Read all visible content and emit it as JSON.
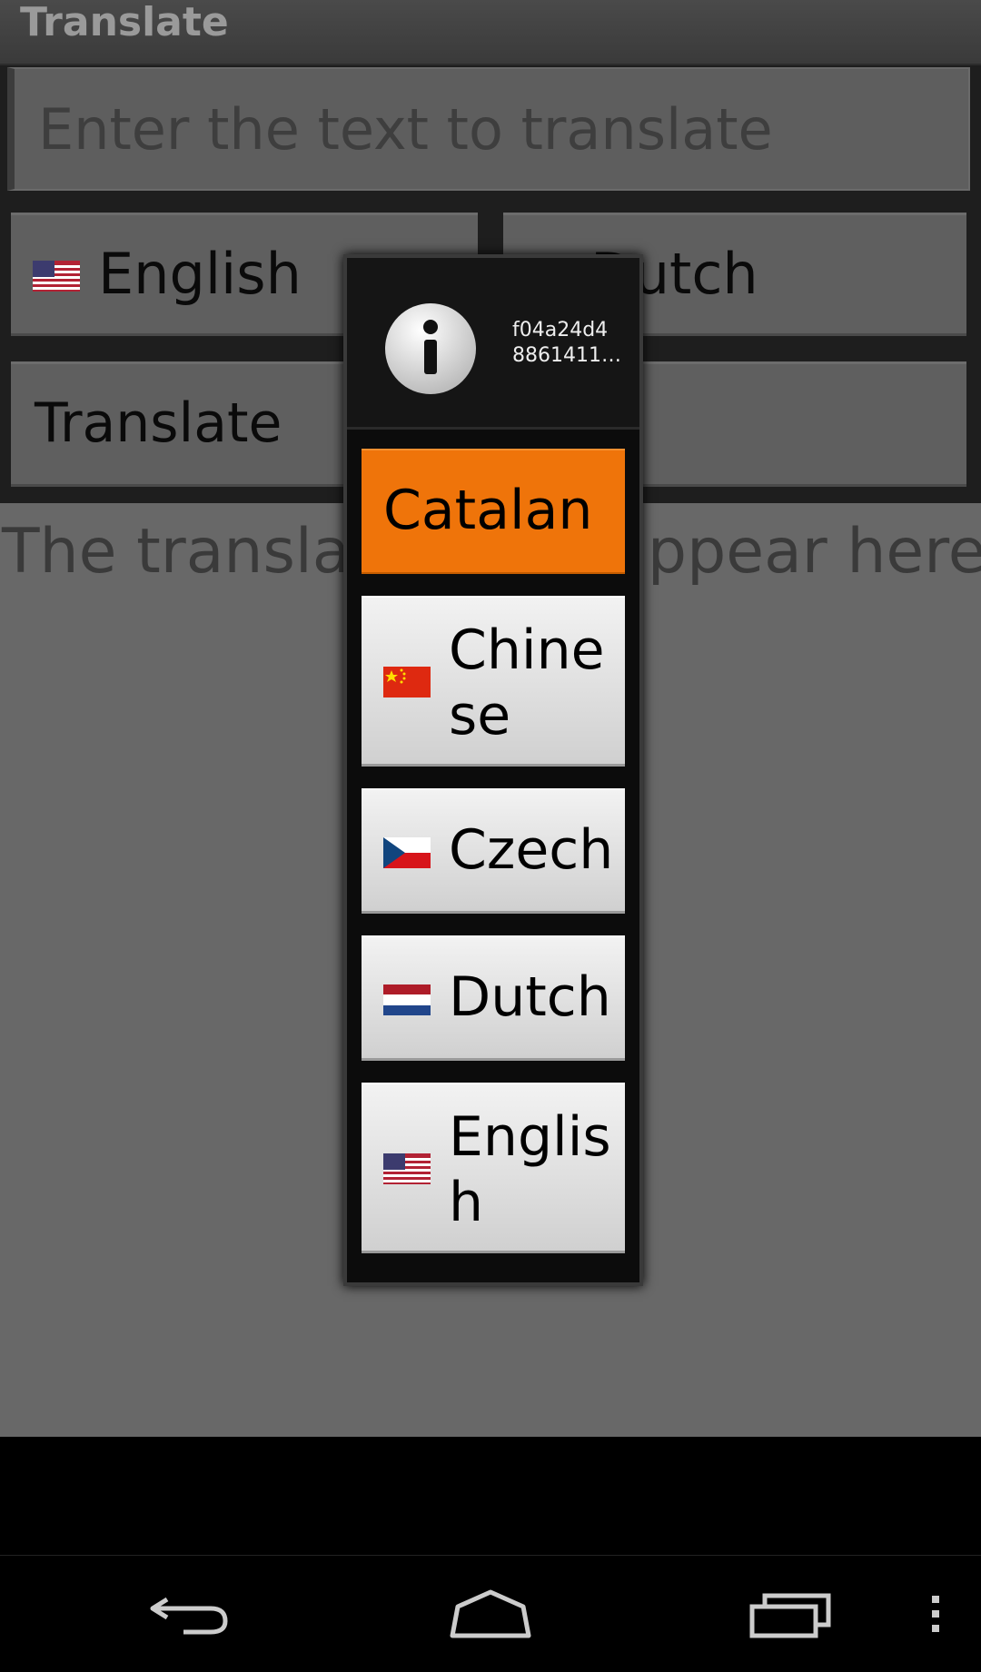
{
  "app": {
    "title": "Translate"
  },
  "input": {
    "placeholder": "Enter the text to translate"
  },
  "source_language": {
    "label": "English",
    "flag_icon": "us-flag-icon"
  },
  "target_language": {
    "label": "Dutch",
    "flag_icon": "netherlands-flag-icon"
  },
  "translate_button": {
    "label": "Translate"
  },
  "output": {
    "placeholder": "The translation will appear here"
  },
  "dialog": {
    "icon": "info-icon",
    "id_line1": "f04a24d4",
    "id_line2": "8861411…",
    "options": [
      {
        "label": "Catalan",
        "selected": true
      },
      {
        "label_line1": "Chine",
        "label_line2": "se",
        "flag_icon": "china-flag-icon"
      },
      {
        "label": "Czech",
        "flag_icon": "czech-flag-icon"
      },
      {
        "label": "Dutch",
        "flag_icon": "netherlands-flag-icon"
      },
      {
        "label_line1": "Englis",
        "label_line2": "h",
        "flag_icon": "us-flag-icon"
      }
    ]
  },
  "navbar": {
    "buttons": [
      "back-icon",
      "home-icon",
      "recent-apps-icon",
      "menu-icon"
    ]
  },
  "colors": {
    "accent": "#ef740a",
    "background": "#686868"
  }
}
